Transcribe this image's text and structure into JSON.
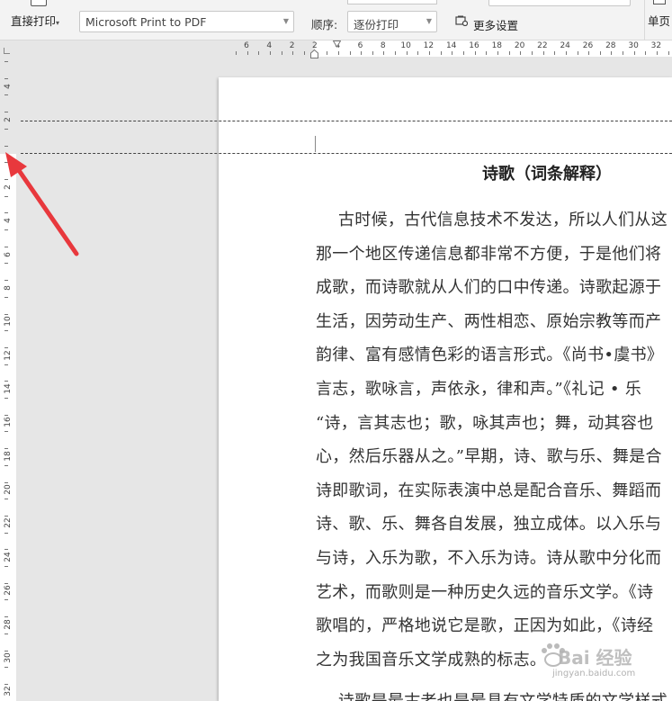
{
  "toolbar": {
    "print_label": "直接打印",
    "printer_value": "Microsoft Print to PDF",
    "order_label": "顺序:",
    "order_value": "逐份打印",
    "more_settings_label": "更多设置",
    "single_page_label": "单页"
  },
  "h_ruler": {
    "numbers": [
      "6",
      "4",
      "2",
      "2",
      "4",
      "6",
      "8",
      "10",
      "12",
      "14",
      "16",
      "18",
      "20",
      "22",
      "24",
      "26",
      "28",
      "30",
      "32"
    ]
  },
  "v_ruler": {
    "numbers": [
      "4",
      "2",
      "2",
      "4",
      "6",
      "8",
      "10",
      "12",
      "14",
      "16",
      "18",
      "20",
      "22",
      "24",
      "26",
      "28",
      "30",
      "32"
    ]
  },
  "document": {
    "title": "诗歌（词条解释）",
    "lines": [
      "古时候，古代信息技术不发达，所以人们从这",
      "那一个地区传递信息都非常不方便，于是他们将",
      "成歌，而诗歌就从人们的口中传递。诗歌起源于",
      "生活，因劳动生产、两性相恋、原始宗教等而产",
      "韵律、富有感情色彩的语言形式。《尚书•虞书》",
      "言志，歌咏言，声依永，律和声。”《礼记 • 乐",
      "“诗，言其志也；歌，咏其声也；舞，动其容也",
      "心，然后乐器从之。”早期，诗、歌与乐、舞是合",
      "诗即歌词，在实际表演中总是配合音乐、舞蹈而",
      "诗、歌、乐、舞各自发展，独立成体。以入乐与",
      "与诗，入乐为歌，不入乐为诗。诗从歌中分化而",
      "艺术，而歌则是一种历史久远的音乐文学。《诗",
      "歌唱的，严格地说它是歌，正因为如此，《诗经",
      "之为我国音乐文学成熟的标志。",
      "诗歌是最古老也是最具有文学特质的文学样式"
    ]
  },
  "watermark": {
    "brand": "Bai 经验",
    "url": "jingyan.baidu.com"
  },
  "colors": {
    "annotation_arrow": "#e8383d",
    "toolbar_bg": "#f3f3f3",
    "workspace_bg": "#e6e6e6"
  }
}
